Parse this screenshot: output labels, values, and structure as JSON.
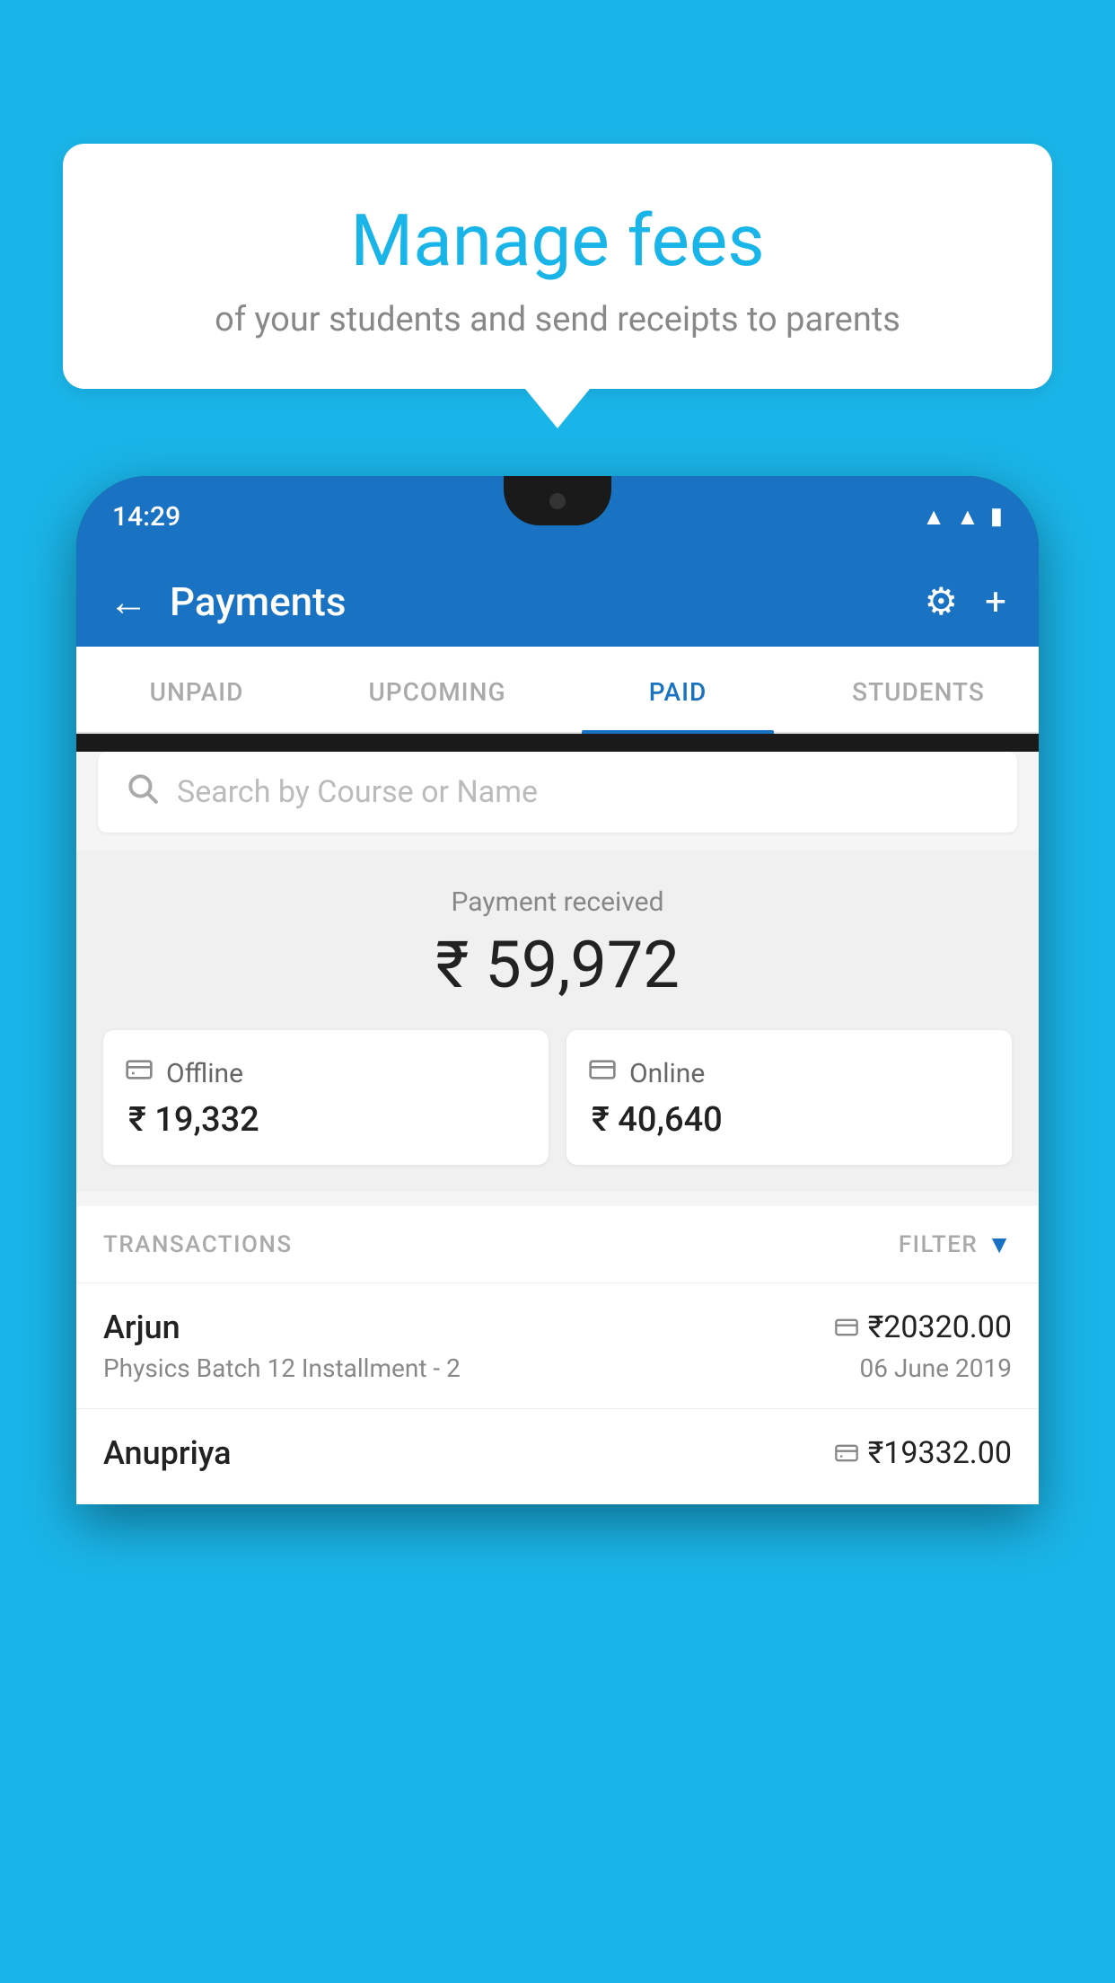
{
  "background": {
    "color": "#1ab5e8"
  },
  "speech_bubble": {
    "title": "Manage fees",
    "subtitle": "of your students and send receipts to parents"
  },
  "status_bar": {
    "time": "14:29",
    "wifi_icon": "▲",
    "signal_icon": "▲",
    "battery_icon": "▮"
  },
  "header": {
    "back_label": "←",
    "title": "Payments",
    "gear_label": "⚙",
    "plus_label": "+"
  },
  "tabs": [
    {
      "label": "UNPAID",
      "active": false
    },
    {
      "label": "UPCOMING",
      "active": false
    },
    {
      "label": "PAID",
      "active": true
    },
    {
      "label": "STUDENTS",
      "active": false
    }
  ],
  "search": {
    "placeholder": "Search by Course or Name"
  },
  "payment_summary": {
    "label": "Payment received",
    "total": "₹ 59,972",
    "offline": {
      "label": "Offline",
      "amount": "₹ 19,332"
    },
    "online": {
      "label": "Online",
      "amount": "₹ 40,640"
    }
  },
  "transactions": {
    "section_label": "TRANSACTIONS",
    "filter_label": "FILTER",
    "items": [
      {
        "name": "Arjun",
        "course": "Physics Batch 12 Installment - 2",
        "amount": "₹20320.00",
        "date": "06 June 2019",
        "payment_type": "online"
      },
      {
        "name": "Anupriya",
        "course": "",
        "amount": "₹19332.00",
        "date": "",
        "payment_type": "offline"
      }
    ]
  }
}
